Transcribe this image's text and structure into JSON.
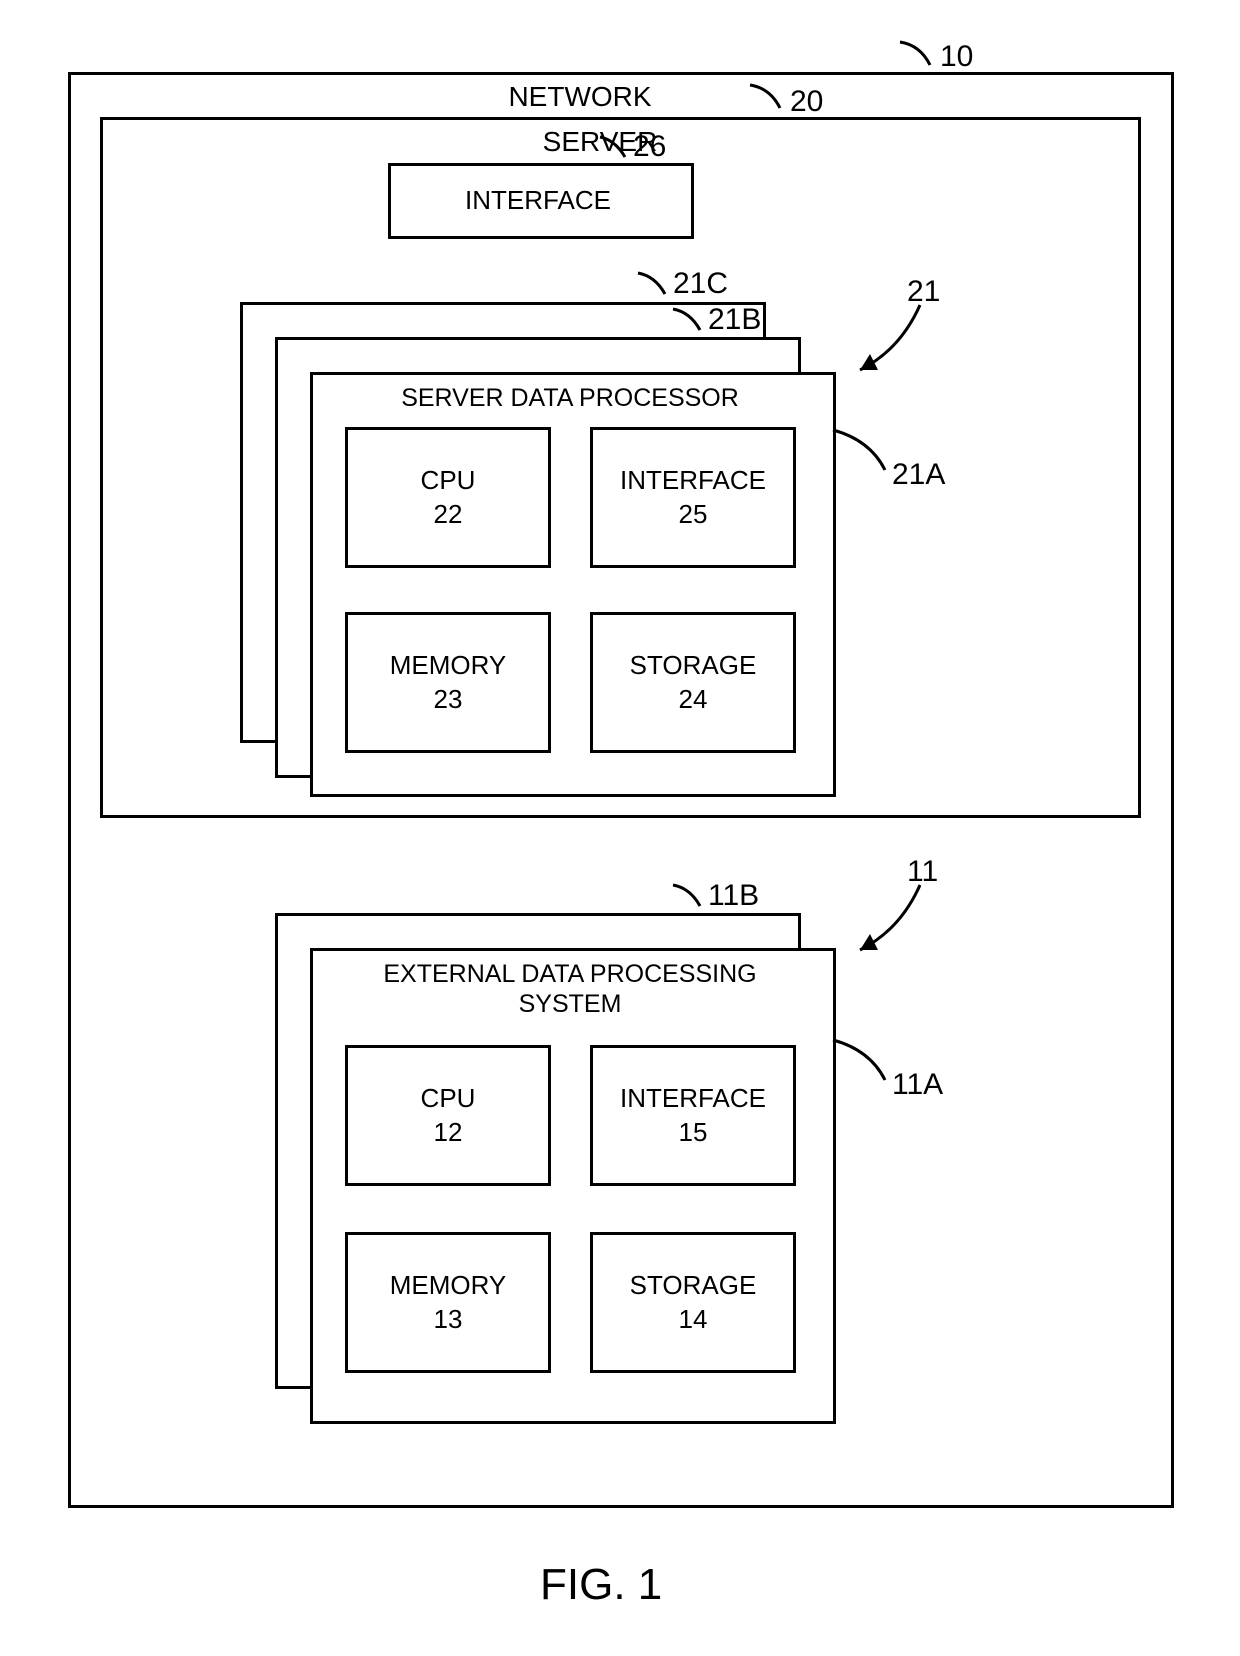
{
  "networkLabel": "NETWORK",
  "networkRef": "10",
  "serverLabel": "SERVER",
  "serverRef": "20",
  "serverInterfaceLabel": "INTERFACE",
  "serverInterfaceRef": "26",
  "sdpGroupRef": "21",
  "sdpRefC": "21C",
  "sdpRefB": "21B",
  "sdpRefA": "21A",
  "sdpTitle": "SERVER DATA PROCESSOR",
  "sdpCpu": "CPU",
  "sdpCpuRef": "22",
  "sdpInterface": "INTERFACE",
  "sdpInterfaceRef": "25",
  "sdpMemory": "MEMORY",
  "sdpMemoryRef": "23",
  "sdpStorage": "STORAGE",
  "sdpStorageRef": "24",
  "edpGroupRef": "11",
  "edpRefB": "11B",
  "edpRefA": "11A",
  "edpTitle1": "EXTERNAL DATA PROCESSING",
  "edpTitle2": "SYSTEM",
  "edpCpu": "CPU",
  "edpCpuRef": "12",
  "edpInterface": "INTERFACE",
  "edpInterfaceRef": "15",
  "edpMemory": "MEMORY",
  "edpMemoryRef": "13",
  "edpStorage": "STORAGE",
  "edpStorageRef": "14",
  "figureLabel": "FIG. 1"
}
